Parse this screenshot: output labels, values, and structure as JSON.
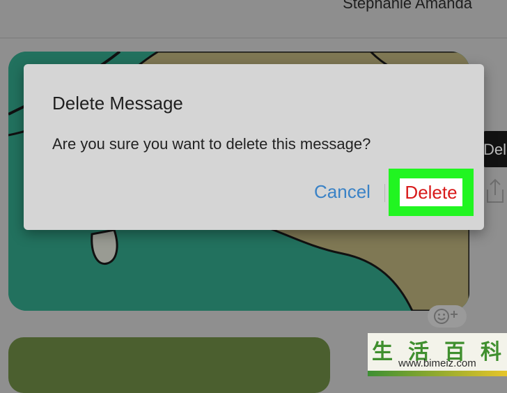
{
  "header": {
    "contact_name": "Stephanie Amanda"
  },
  "background": {
    "image_message": "image",
    "side_action_label": "Delete"
  },
  "dialog": {
    "title": "Delete Message",
    "message": "Are you sure you want to delete this message?",
    "cancel_label": "Cancel",
    "delete_label": "Delete"
  },
  "watermark": {
    "logo_text": "生活百科",
    "url": "www.bimeiz.com"
  },
  "colors": {
    "overlay_gray": "#8f8f8f",
    "dialog_bg": "#d5d5d5",
    "cancel_blue": "#3a82c6",
    "delete_red": "#d81a1a",
    "highlight_green": "#21f521"
  },
  "icons": [
    "share-icon",
    "emoji-reaction-icon"
  ]
}
